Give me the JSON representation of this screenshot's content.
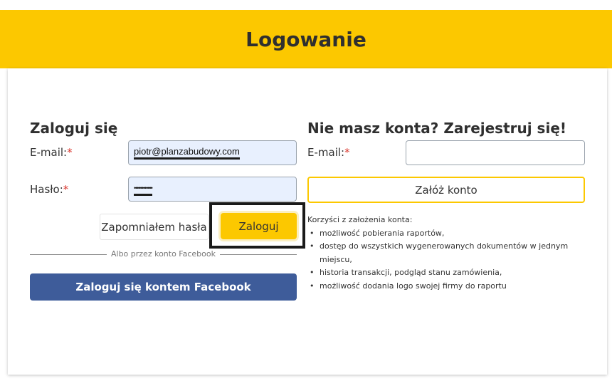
{
  "header": {
    "title": "Logowanie"
  },
  "login": {
    "heading": "Zaloguj się",
    "email_label": "E-mail:",
    "email_value": "piotr@planzabudowy.com",
    "password_label": "Hasło:",
    "password_value": "••••••••••••",
    "required_mark": "*",
    "forgot_label": "Zapomniałem hasła",
    "submit_label": "Zaloguj",
    "divider_text": "Albo przez konto Facebook",
    "facebook_label": "Zaloguj się kontem Facebook"
  },
  "register": {
    "heading": "Nie masz konta? Zarejestruj się!",
    "email_label": "E-mail:",
    "email_value": "",
    "required_mark": "*",
    "submit_label": "Załóż konto",
    "benefits_title": "Korzyści z założenia konta:",
    "benefits": [
      "możliwość pobierania raportów,",
      "dostęp do wszystkich wygenerowanych dokumentów w jednym miejscu,",
      "historia transakcji, podgląd stanu zamówienia,",
      "możliwość dodania logo swojej firmy do raportu"
    ]
  },
  "colors": {
    "accent": "#fcc800",
    "facebook": "#3e5c9a",
    "required": "#d9342b"
  }
}
